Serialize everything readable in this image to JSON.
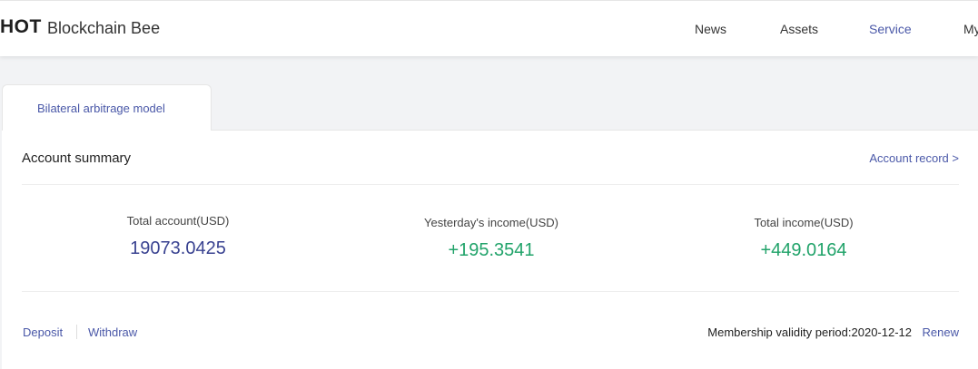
{
  "header": {
    "logo_text": "HOT",
    "brand_name": "Blockchain Bee",
    "nav": [
      {
        "label": "News"
      },
      {
        "label": "Assets"
      },
      {
        "label": "Service"
      },
      {
        "label": "My"
      }
    ],
    "active_nav": "Service"
  },
  "tabs": [
    {
      "label": "Bilateral arbitrage model"
    }
  ],
  "summary": {
    "title": "Account summary",
    "record_link": "Account record >",
    "stats": [
      {
        "label": "Total account(USD)",
        "value": "19073.0425"
      },
      {
        "label": "Yesterday's income(USD)",
        "value": "+195.3541"
      },
      {
        "label": "Total income(USD)",
        "value": "+449.0164"
      }
    ]
  },
  "actions": {
    "deposit": "Deposit",
    "withdraw": "Withdraw",
    "membership": "Membership validity period:2020-12-12",
    "renew": "Renew"
  },
  "colors": {
    "accent": "#4a58a8",
    "income_green": "#21a36a",
    "total_blue": "#3a4391"
  }
}
